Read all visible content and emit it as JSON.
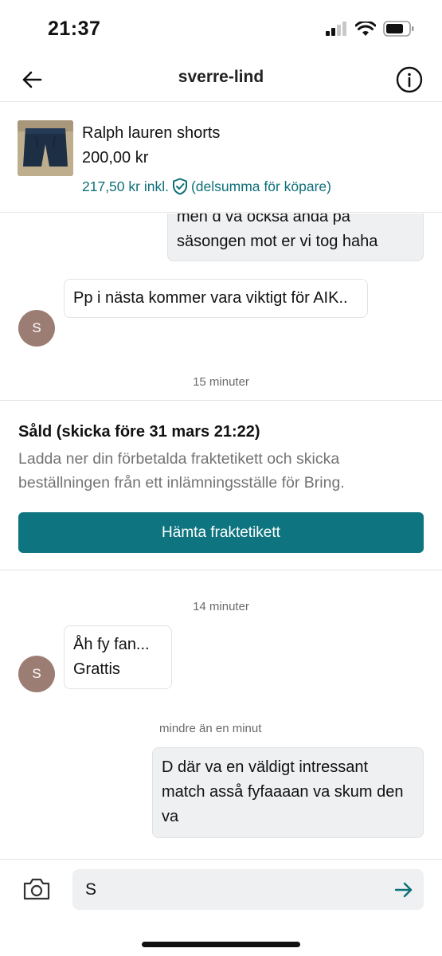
{
  "status_bar": {
    "time": "21:37"
  },
  "header": {
    "title": "sverre-lind",
    "back_icon": "arrow-left-icon",
    "info_icon": "info-icon"
  },
  "item": {
    "title": "Ralph lauren shorts",
    "price": "200,00 kr",
    "buyer_price": "217,50 kr inkl.",
    "buyer_note": "(delsumma för köpare)",
    "accent": "#0e6f78"
  },
  "messages": {
    "partial_out_line1": "men d va också ända på",
    "partial_out_line2": "säsongen mot er vi tog haha",
    "in_1": "Pp i nästa kommer vara viktigt för AIK..",
    "ts_1": "15 minuter",
    "ts_2": "14 minuter",
    "in_2_line1": "Åh fy fan...",
    "in_2_line2": "Grattis",
    "ts_3": "mindre än en minut",
    "out_1": "D där va en väldigt intressant match asså fyfaaaan va skum den va",
    "avatar_letter": "S"
  },
  "sold": {
    "title": "Såld (skicka före 31 mars 21:22)",
    "description": "Ladda ner din förbetalda fraktetikett och skicka beställningen från ett inlämningsställe för Bring.",
    "button_label": "Hämta fraktetikett",
    "button_color": "#0e7580"
  },
  "composer": {
    "value": "S",
    "camera_icon": "camera-icon",
    "send_icon": "send-arrow-icon"
  }
}
